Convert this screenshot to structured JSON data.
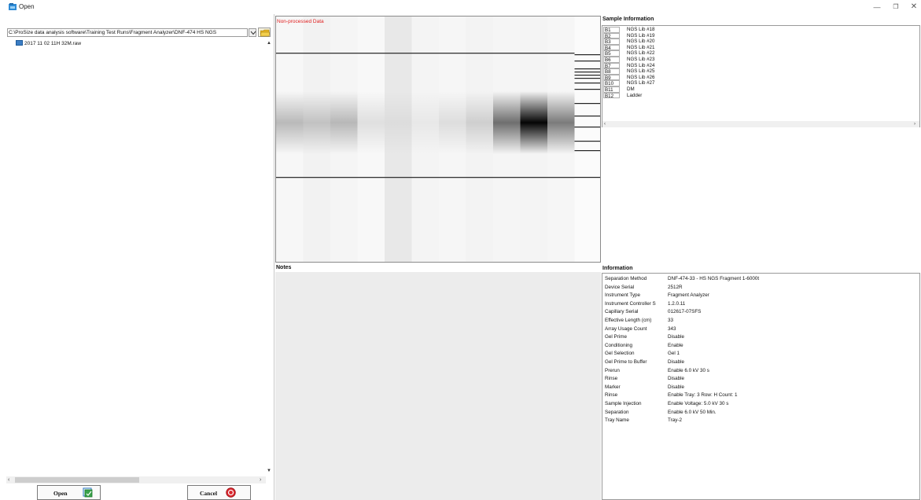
{
  "window": {
    "title": "Open",
    "icon": "app-icon",
    "controls": [
      "minimize-icon",
      "restore-icon",
      "close-icon"
    ]
  },
  "left_pane": {
    "path": "C:\\ProSize data analysis software\\Training Test Runs\\Fragment Analyzer\\DNF-474 HS NGS",
    "file_item": "2017 11 02 11H 32M.raw",
    "open_button": "Open",
    "cancel_button": "Cancel"
  },
  "gel": {
    "label": "Non-processed Data",
    "label_color": "#e02020",
    "lane_count": 12,
    "lane_intensity": [
      0.25,
      0.2,
      0.25,
      0.1,
      0.05,
      0.05,
      0.1,
      0.15,
      0.55,
      0.98,
      0.5,
      0.05
    ],
    "ladder_lane": 12
  },
  "sample_information": {
    "heading": "Sample Information",
    "rows": [
      {
        "well": "B1",
        "name": "NGS Lib #18"
      },
      {
        "well": "B2",
        "name": "NGS Lib #19"
      },
      {
        "well": "B3",
        "name": "NGS Lib #20"
      },
      {
        "well": "B4",
        "name": "NGS Lib #21"
      },
      {
        "well": "B5",
        "name": "NGS Lib #22"
      },
      {
        "well": "B6",
        "name": "NGS Lib #23"
      },
      {
        "well": "B7",
        "name": "NGS Lib #24"
      },
      {
        "well": "B8",
        "name": "NGS Lib #25"
      },
      {
        "well": "B9",
        "name": "NGS Lib #26"
      },
      {
        "well": "B10",
        "name": "NGS Lib #27"
      },
      {
        "well": "B11",
        "name": "DM"
      },
      {
        "well": "B12",
        "name": "Ladder"
      }
    ]
  },
  "notes": {
    "heading": "Notes"
  },
  "information": {
    "heading": "Information",
    "rows": [
      {
        "key": "Separation Method",
        "value": "DNF-474-33 - HS NGS Fragment 1-6000t"
      },
      {
        "key": "Device Serial",
        "value": "2512R"
      },
      {
        "key": "Instrument Type",
        "value": "Fragment Analyzer"
      },
      {
        "key": "Instrument Controller S",
        "value": "1.2.0.11"
      },
      {
        "key": "Capillary Serial",
        "value": "012617-07SFS"
      },
      {
        "key": "Effective Length (cm)",
        "value": "33"
      },
      {
        "key": "Array Usage Count",
        "value": "343"
      },
      {
        "key": "Gel Prime",
        "value": "Disable"
      },
      {
        "key": "Conditioning",
        "value": "Enable"
      },
      {
        "key": "Gel Selection",
        "value": "Gel 1"
      },
      {
        "key": "Gel Prime to Buffer",
        "value": "Disable"
      },
      {
        "key": "Prerun",
        "value": "Enable   6.0 kV   30 s"
      },
      {
        "key": "Rinse",
        "value": "Disable"
      },
      {
        "key": "Marker",
        "value": "Disable"
      },
      {
        "key": "Rinse",
        "value": "Enable   Tray: 3   Row: H   Count: 1"
      },
      {
        "key": "Sample Injection",
        "value": "Enable   Voltage: 5.0 kV   30 s"
      },
      {
        "key": "Separation",
        "value": "Enable   6.0 kV   50 Min."
      },
      {
        "key": "Tray Name",
        "value": "Tray-2"
      }
    ]
  }
}
